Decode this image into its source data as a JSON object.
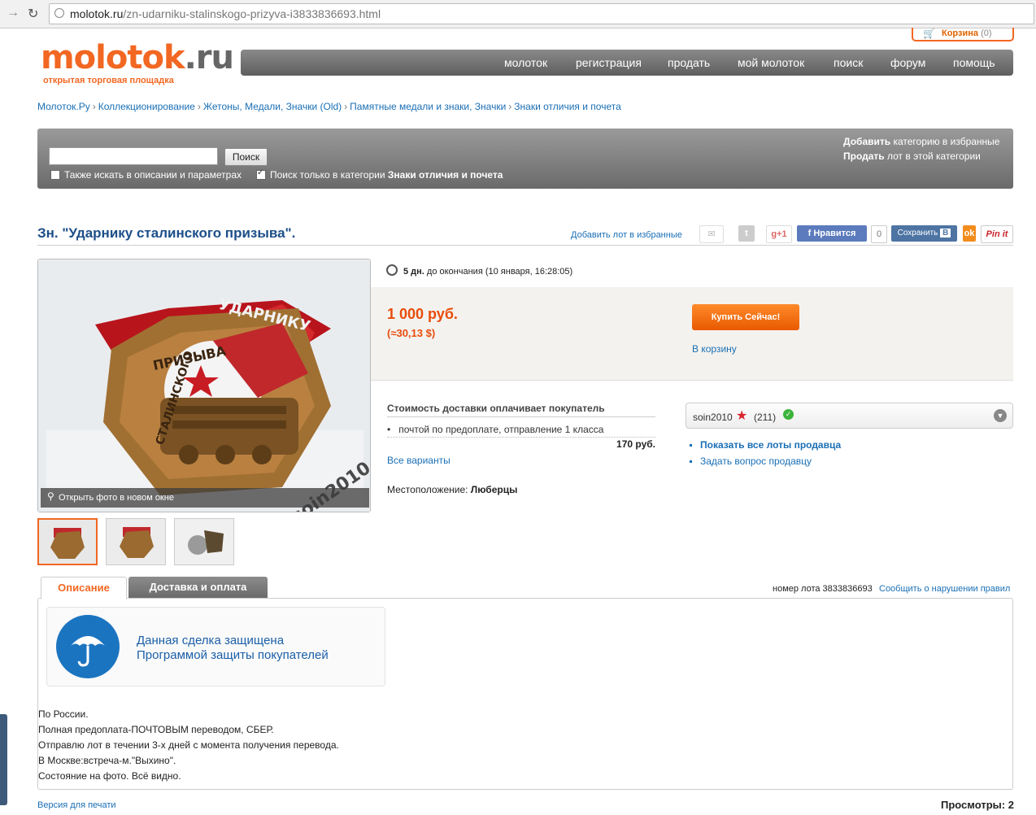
{
  "browser": {
    "url_domain": "molotok.ru",
    "url_path": "/zn-udarniku-stalinskogo-prizyva-i3833836693.html"
  },
  "header": {
    "logo_main": "molotok",
    "logo_tld": ".ru",
    "logo_subtitle": "открытая торговая площадка",
    "cart_label": "Корзина",
    "cart_count": "(0)",
    "nav": [
      "молоток",
      "регистрация",
      "продать",
      "мой молоток",
      "поиск",
      "форум",
      "помощь"
    ]
  },
  "breadcrumbs": [
    "Молоток.Ру",
    "Коллекционирование",
    "Жетоны, Медали, Значки (Old)",
    "Памятные медали и знаки, Значки",
    "Знаки отличия и почета"
  ],
  "search": {
    "input_value": "",
    "button": "Поиск",
    "opt1_label": "Также искать в описании и параметрах",
    "opt1_checked": false,
    "opt2_prefix": "Поиск только в категории ",
    "opt2_category": "Знаки отличия и почета",
    "opt2_checked": true,
    "add_fav_bold": "Добавить",
    "add_fav_rest": " категорию в избранные",
    "sell_bold": "Продать",
    "sell_rest": " лот в этой категории"
  },
  "lot": {
    "title": "Зн. \"Ударнику сталинского призыва\".",
    "add_favorite": "Добавить лот в избранные",
    "social": {
      "gplus": "g+1",
      "like": "Нравится",
      "like_count": "0",
      "save": "Сохранить",
      "vk": "В",
      "pinit": "Pin it"
    },
    "photo_watermark": "soin2010",
    "photo_badge_text_top": "УДАРНИКУ",
    "photo_badge_text_mid": "ПРИЗЫВА",
    "photo_badge_text_left": "СТАЛИНСКОГО",
    "open_photo": "Открыть фото в новом окне",
    "timer_bold": "5 дн.",
    "timer_rest": " до окончания (10 января, 16:28:05)",
    "price": "1 000 руб.",
    "price_usd": "(≈30,13 $)",
    "buy_button": "Купить Сейчас!",
    "to_cart": "В корзину",
    "shipping_header": "Стоимость доставки оплачивает покупатель",
    "shipping_item": "почтой по предоплате, отправление 1 класса",
    "shipping_price": "170 руб.",
    "all_options": "Все варианты",
    "location_label": "Местоположение: ",
    "location_value": "Люберцы",
    "seller_name": "soin2010",
    "seller_rating": "(211)",
    "show_all_lots": "Показать все лоты продавца",
    "ask_seller": "Задать вопрос продавцу"
  },
  "tabs": [
    "Описание",
    "Доставка и оплата"
  ],
  "lot_number_label": "номер лота 3833836693",
  "report_link": "Сообщить о нарушении правил",
  "protection": {
    "line1": "Данная сделка защищена",
    "line2": "Программой защиты покупателей"
  },
  "description": [
    "По России.",
    "Полная предоплата-ПОЧТОВЫМ переводом, СБЕР.",
    "Отправлю лот в течении 3-х дней с момента получения перевода.",
    "В Москве:встреча-м.\"Выхино\".",
    "Состояние на фото. Всё видно."
  ],
  "footer": {
    "print_version": "Версия для печати",
    "views": "Просмотры: 2"
  },
  "colors": {
    "brand_orange": "#f26722",
    "link_blue": "#1a6fb5",
    "price_red": "#e84c0c"
  }
}
